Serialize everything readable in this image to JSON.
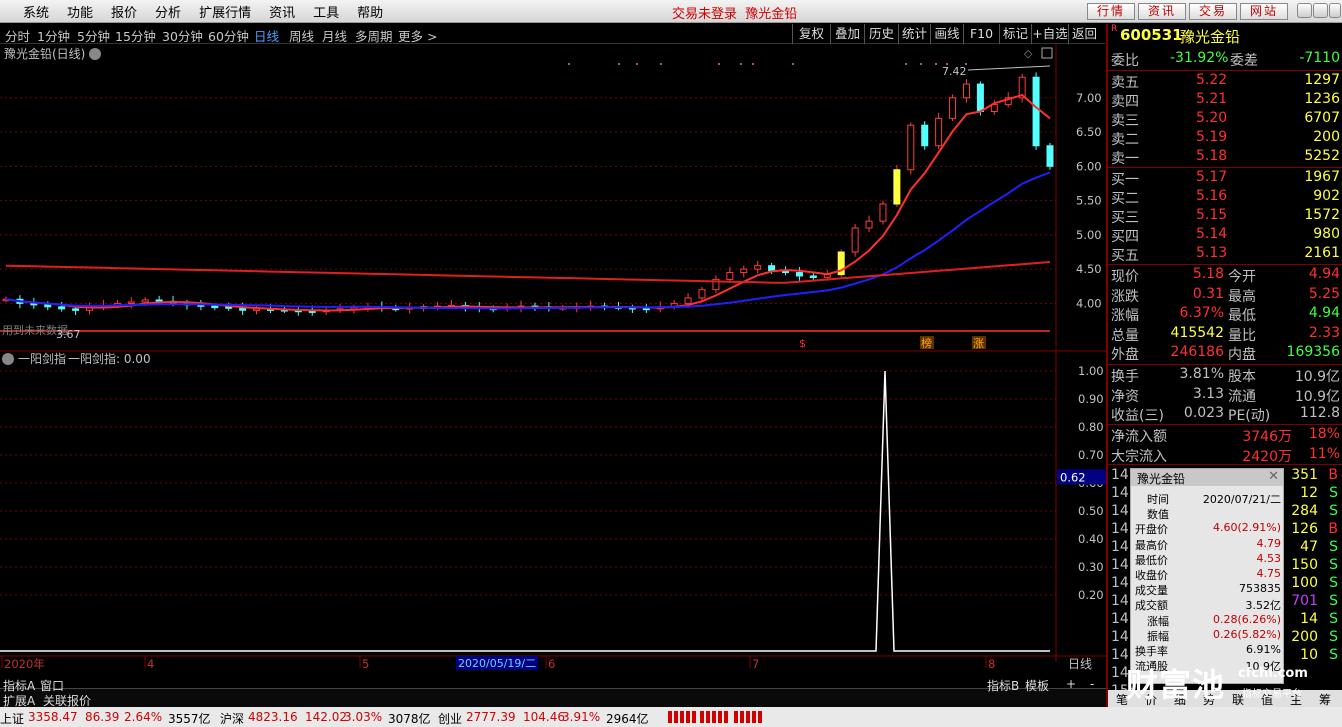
{
  "menu": {
    "items": [
      "系统",
      "功能",
      "报价",
      "分析",
      "扩展行情",
      "资讯",
      "工具",
      "帮助"
    ],
    "trade_notice": "交易未登录",
    "stock_title": "豫光金铅",
    "buttons": [
      "行情",
      "资讯",
      "交易",
      "网站"
    ]
  },
  "periods": {
    "items": [
      "分时",
      "1分钟",
      "5分钟",
      "15分钟",
      "30分钟",
      "60分钟",
      "日线",
      "周线",
      "月线",
      "多周期",
      "更多 >"
    ],
    "active": "日线"
  },
  "tools": [
    "复权",
    "叠加",
    "历史",
    "统计",
    "画线",
    "F10",
    "标记",
    "+自选",
    "返回"
  ],
  "main_chart": {
    "title": "豫光金铅(日线)",
    "max_label": "7.42",
    "min_label": "3.67",
    "future_label": "用到未来数据",
    "markers": [
      "$",
      "榜",
      "涨"
    ]
  },
  "price_axis": [
    "7.00",
    "6.50",
    "6.00",
    "5.50",
    "5.00",
    "4.50",
    "4.00"
  ],
  "indicator": {
    "title": "一阳剑指",
    "value_label": "一阳剑指: 0.00",
    "axis": [
      "1.00",
      "0.90",
      "0.80",
      "0.70",
      "0.60",
      "0.50",
      "0.40",
      "0.30",
      "0.20"
    ],
    "cursor_value": "0.62"
  },
  "date_axis": {
    "labels": [
      "2020年",
      "4",
      "5",
      "6",
      "7",
      "8"
    ],
    "cursor_date": "2020/05/19/二",
    "period": "日线"
  },
  "bottom_tabs": {
    "left": [
      "指标A",
      "窗口",
      "扩展A",
      "关联报价"
    ],
    "right": [
      "指标B",
      "模板",
      "+",
      "-"
    ]
  },
  "quote": {
    "code": "600531",
    "name": "豫光金铅",
    "r": "R",
    "weibi_label": "委比",
    "weibi": "-31.92%",
    "weicha_label": "委差",
    "weicha": "-7110",
    "sell": [
      {
        "label": "卖五",
        "price": "5.22",
        "vol": "1297"
      },
      {
        "label": "卖四",
        "price": "5.21",
        "vol": "1236"
      },
      {
        "label": "卖三",
        "price": "5.20",
        "vol": "6707"
      },
      {
        "label": "卖二",
        "price": "5.19",
        "vol": "200"
      },
      {
        "label": "卖一",
        "price": "5.18",
        "vol": "5252"
      }
    ],
    "buy": [
      {
        "label": "买一",
        "price": "5.17",
        "vol": "1967"
      },
      {
        "label": "买二",
        "price": "5.16",
        "vol": "902"
      },
      {
        "label": "买三",
        "price": "5.15",
        "vol": "1572"
      },
      {
        "label": "买四",
        "price": "5.14",
        "vol": "980"
      },
      {
        "label": "买五",
        "price": "5.13",
        "vol": "2161"
      }
    ],
    "stats": [
      {
        "l1": "现价",
        "v1": "5.18",
        "l2": "今开",
        "v2": "4.94"
      },
      {
        "l1": "涨跌",
        "v1": "0.31",
        "l2": "最高",
        "v2": "5.25"
      },
      {
        "l1": "涨幅",
        "v1": "6.37%",
        "l2": "最低",
        "v2": "4.94"
      },
      {
        "l1": "总量",
        "v1": "415542",
        "l2": "量比",
        "v2": "2.33"
      },
      {
        "l1": "外盘",
        "v1": "246186",
        "l2": "内盘",
        "v2": "169356"
      }
    ],
    "stats2": [
      {
        "l1": "换手",
        "v1": "3.81%",
        "l2": "股本",
        "v2": "10.9亿"
      },
      {
        "l1": "净资",
        "v1": "3.13",
        "l2": "流通",
        "v2": "10.9亿"
      },
      {
        "l1": "收益(三)",
        "v1": "0.023",
        "l2": "PE(动)",
        "v2": "112.8"
      }
    ],
    "flows": [
      {
        "label": "净流入额",
        "value": "3746万",
        "pct": "18%"
      },
      {
        "label": "大宗流入",
        "value": "2420万",
        "pct": "11%"
      }
    ],
    "ticks": [
      {
        "t": "14:",
        "v": "351",
        "s": "B"
      },
      {
        "t": "14:",
        "v": "12",
        "s": "S"
      },
      {
        "t": "14:",
        "v": "284",
        "s": "S"
      },
      {
        "t": "14:",
        "v": "126",
        "s": "B"
      },
      {
        "t": "14:",
        "v": "47",
        "s": "S"
      },
      {
        "t": "14:",
        "v": "150",
        "s": "S"
      },
      {
        "t": "14:",
        "v": "100",
        "s": "S"
      },
      {
        "t": "14:",
        "v": "701",
        "s": "S"
      },
      {
        "t": "14:",
        "v": "14",
        "s": "S"
      },
      {
        "t": "14:",
        "v": "200",
        "s": "S"
      },
      {
        "t": "14:",
        "v": "10",
        "s": "S"
      },
      {
        "t": "14:",
        "v": "",
        "s": ""
      },
      {
        "t": "15:",
        "v": "",
        "s": ""
      }
    ],
    "tabs": [
      "笔",
      "价",
      "细",
      "势",
      "联",
      "值",
      "主",
      "筹"
    ]
  },
  "popup": {
    "title": "豫光金铅",
    "rows": [
      {
        "k": "时间",
        "v": "2020/07/21/二"
      },
      {
        "k": "数值",
        "v": ""
      },
      {
        "k": "开盘价",
        "v": "4.60(2.91%)"
      },
      {
        "k": "最高价",
        "v": "4.79"
      },
      {
        "k": "最低价",
        "v": "4.53"
      },
      {
        "k": "收盘价",
        "v": "4.75"
      },
      {
        "k": "成交量",
        "v": "753835"
      },
      {
        "k": "成交额",
        "v": "3.52亿"
      },
      {
        "k": "涨幅",
        "v": "0.28(6.26%)"
      },
      {
        "k": "振幅",
        "v": "0.26(5.82%)"
      },
      {
        "k": "换手率",
        "v": "6.91%"
      },
      {
        "k": "流通股",
        "v": "10.9亿"
      }
    ]
  },
  "watermark": {
    "brand": "财富池",
    "site": "cfchi.com",
    "sub": "指标交易平台"
  },
  "statusbar": [
    {
      "name": "上证",
      "value": "3358.47",
      "chg": "86.39",
      "pct": "2.64%",
      "amt": "3557亿"
    },
    {
      "name": "沪深",
      "value": "4823.16",
      "chg": "142.02",
      "pct": "3.03%",
      "amt": "3078亿"
    },
    {
      "name": "创业",
      "value": "2777.39",
      "chg": "104.46",
      "pct": "3.91%",
      "amt": "2964亿"
    }
  ],
  "chart_data": {
    "type": "candlestick",
    "x_range": [
      "2020-01",
      "2020-08"
    ],
    "y_range": [
      3.67,
      7.42
    ],
    "indicator_peak": 1.0,
    "closes": [
      4.06,
      4.0,
      3.98,
      3.95,
      3.92,
      3.9,
      3.95,
      3.97,
      4.0,
      4.02,
      4.05,
      4.03,
      4.0,
      3.98,
      3.96,
      3.95,
      3.93,
      3.9,
      3.92,
      3.91,
      3.9,
      3.89,
      3.88,
      3.9,
      3.92,
      3.94,
      3.95,
      3.93,
      3.92,
      3.94,
      3.95,
      3.96,
      3.97,
      3.95,
      3.93,
      3.92,
      3.94,
      3.96,
      3.95,
      3.93,
      3.94,
      3.95,
      3.96,
      3.95,
      3.94,
      3.93,
      3.92,
      3.95,
      4.0,
      4.08,
      4.2,
      4.35,
      4.45,
      4.5,
      4.55,
      4.48,
      4.45,
      4.4,
      4.38,
      4.42,
      4.75,
      5.1,
      5.2,
      5.45,
      5.95,
      6.6,
      6.3,
      6.7,
      7.0,
      7.2,
      6.8,
      6.9,
      7.0,
      7.3,
      6.3,
      6.0
    ]
  }
}
